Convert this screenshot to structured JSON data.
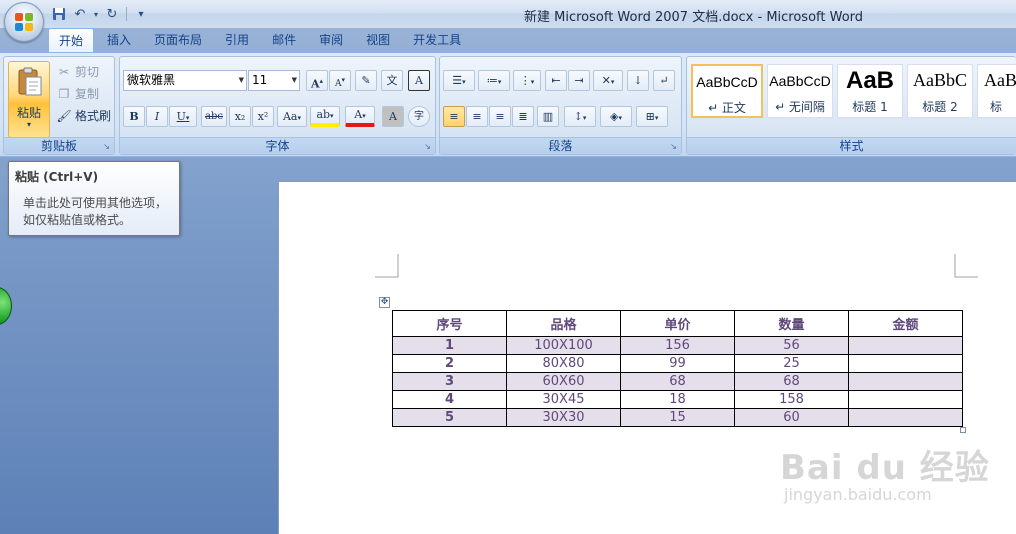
{
  "window": {
    "title": "新建 Microsoft Word 2007 文档.docx - Microsoft Word"
  },
  "quick_access": [
    {
      "name": "save-icon",
      "glyph": "💾"
    },
    {
      "name": "undo-icon",
      "glyph": "↶"
    },
    {
      "name": "dropdown-icon",
      "glyph": "▾"
    },
    {
      "name": "redo-icon",
      "glyph": "↻"
    },
    {
      "name": "customize-icon",
      "glyph": "⁼"
    }
  ],
  "tabs": [
    "开始",
    "插入",
    "页面布局",
    "引用",
    "邮件",
    "审阅",
    "视图",
    "开发工具"
  ],
  "ribbon": {
    "clipboard": {
      "label": "剪贴板",
      "paste": "粘贴",
      "cut": "剪切",
      "copy": "复制",
      "format_painter": "格式刷"
    },
    "font": {
      "label": "字体",
      "font_name": "微软雅黑",
      "font_size": "11",
      "grow": "A",
      "shrink": "A",
      "phonetic": "文",
      "border_char": "A",
      "bold": "B",
      "italic": "I",
      "underline": "U",
      "strikethrough": "abc",
      "subscript": "x₂",
      "superscript": "x²",
      "change_case": "Aa",
      "highlight": "ab",
      "font_color": "A",
      "shading_char": "A",
      "enclose": "字"
    },
    "paragraph": {
      "label": "段落"
    },
    "styles": {
      "label": "样式",
      "items": [
        {
          "sample": "AaBbCcD",
          "name": "↵ 正文"
        },
        {
          "sample": "AaBbCcD",
          "name": "↵ 无间隔"
        },
        {
          "sample": "AaB",
          "name": "标题 1"
        },
        {
          "sample": "AaBbC",
          "name": "标题 2"
        },
        {
          "sample": "AaB",
          "name": "标"
        }
      ]
    }
  },
  "tooltip": {
    "title": "粘贴 (Ctrl+V)",
    "body_line1": "单击此处可使用其他选项，",
    "body_line2": "如仅粘贴值或格式。"
  },
  "table": {
    "headers": [
      "序号",
      "品格",
      "单价",
      "数量",
      "金额"
    ],
    "rows": [
      [
        "1",
        "100X100",
        "156",
        "56",
        ""
      ],
      [
        "2",
        "80X80",
        "99",
        "25",
        ""
      ],
      [
        "3",
        "60X60",
        "68",
        "68",
        ""
      ],
      [
        "4",
        "30X45",
        "18",
        "158",
        ""
      ],
      [
        "5",
        "30X30",
        "15",
        "60",
        ""
      ]
    ]
  },
  "watermark": {
    "main": "Bai du 经验",
    "sub": "jingyan.baidu.com"
  }
}
